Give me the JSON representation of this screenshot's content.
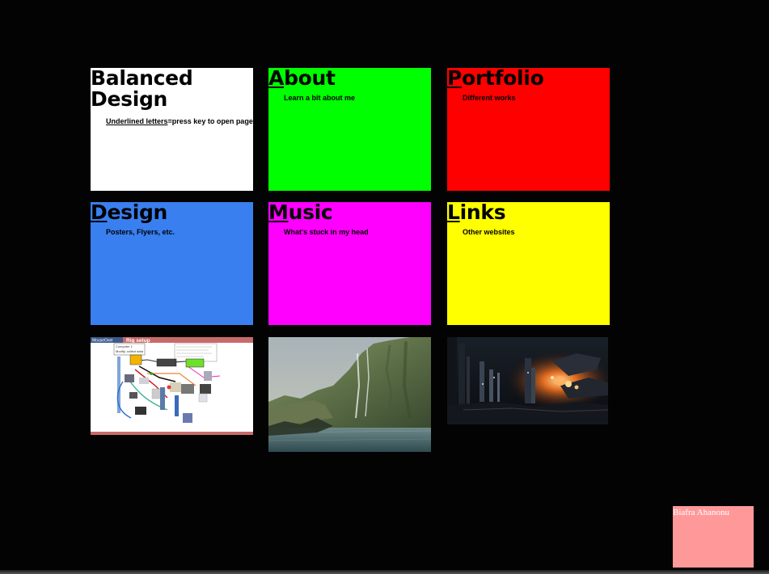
{
  "tiles": {
    "home": {
      "title_line1": "Balanced",
      "title_line2": "Design",
      "hint_underlined": "Underlined letters",
      "hint_rest": "=press key to open page!",
      "color": "#ffffff"
    },
    "about": {
      "key": "A",
      "title_rest": "bout",
      "subtitle": "Learn a bit about me",
      "color": "#00ff00"
    },
    "portfolio": {
      "key": "P",
      "title_rest": "ortfolio",
      "subtitle": "Different works",
      "color": "#ff0000"
    },
    "design": {
      "key": "D",
      "title_rest": "esign",
      "subtitle": "Posters, Flyers, etc.",
      "color": "#3a7ff0"
    },
    "music": {
      "key": "M",
      "title_rest": "usic",
      "subtitle": "What's stuck in my head",
      "color": "#ff00ff"
    },
    "links": {
      "key": "L",
      "title_rest": "inks",
      "subtitle": "Other websites",
      "color": "#ffff00"
    }
  },
  "images": {
    "diagram": {
      "tab_label": "MouseOver",
      "heading": "Rig setup",
      "note1": "Computer 1",
      "note2": "Modify, collect data"
    }
  },
  "footer": {
    "name": "Biafra Ahanonu",
    "name_box_color": "#ff9999"
  }
}
